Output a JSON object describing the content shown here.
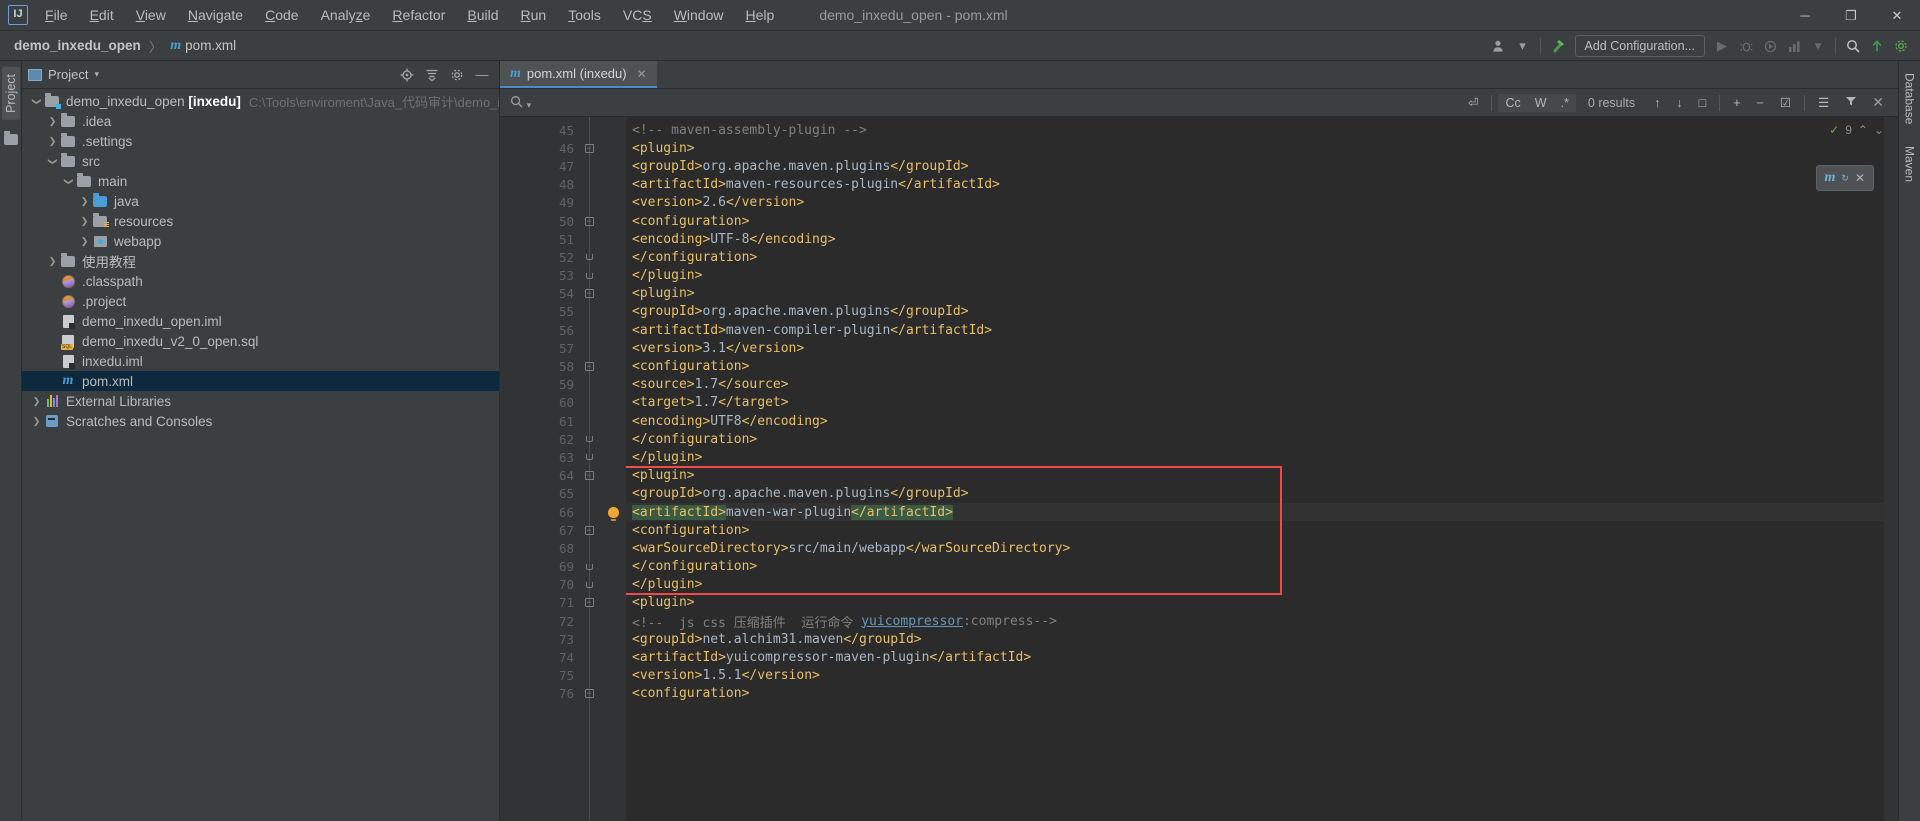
{
  "titlebar": {
    "logo": "IJ",
    "menus": [
      {
        "label": "File",
        "mnemonic": "F"
      },
      {
        "label": "Edit",
        "mnemonic": "E"
      },
      {
        "label": "View",
        "mnemonic": "V"
      },
      {
        "label": "Navigate",
        "mnemonic": "N"
      },
      {
        "label": "Code",
        "mnemonic": "C"
      },
      {
        "label": "Analyze",
        "mnemonic": "z"
      },
      {
        "label": "Refactor",
        "mnemonic": "R"
      },
      {
        "label": "Build",
        "mnemonic": "B"
      },
      {
        "label": "Run",
        "mnemonic": "R"
      },
      {
        "label": "Tools",
        "mnemonic": "T"
      },
      {
        "label": "VCS",
        "mnemonic": "S"
      },
      {
        "label": "Window",
        "mnemonic": "W"
      },
      {
        "label": "Help",
        "mnemonic": "H"
      }
    ],
    "window_title": "demo_inxedu_open - pom.xml",
    "minimize": "─",
    "maximize": "❐",
    "close": "✕"
  },
  "navbar": {
    "breadcrumb": [
      "demo_inxedu_open",
      "pom.xml"
    ],
    "separator": "〉",
    "file_icon": "maven-m-icon",
    "add_configuration": "Add Configuration...",
    "icons": [
      "user-avatar-icon",
      "chevron-down-icon",
      "build-hammer-icon",
      "run-icon",
      "debug-icon",
      "stop-icon",
      "coverage-icon",
      "profile-icon",
      "more-chevron-icon",
      "search-everywhere-icon",
      "update-project-icon",
      "settings-gear-icon"
    ]
  },
  "left_rail": {
    "tab": "Project",
    "extra_icon": "folder-icon"
  },
  "project_panel": {
    "title": "Project",
    "header_icons": [
      "target-locate-icon",
      "collapse-all-icon",
      "settings-gear-icon",
      "hide-icon"
    ],
    "tree": [
      {
        "indent": 0,
        "arrow": "v",
        "icon": "module-folder",
        "label": "demo_inxedu_open",
        "bold": "[inxedu]",
        "path": "C:\\Tools\\enviroment\\Java_代码审计\\demo_inx",
        "selected": false
      },
      {
        "indent": 1,
        "arrow": ">",
        "icon": "folder",
        "label": ".idea",
        "selected": false
      },
      {
        "indent": 1,
        "arrow": ">",
        "icon": "folder",
        "label": ".settings",
        "selected": false
      },
      {
        "indent": 1,
        "arrow": "v",
        "icon": "folder",
        "label": "src",
        "selected": false
      },
      {
        "indent": 2,
        "arrow": "v",
        "icon": "folder",
        "label": "main",
        "selected": false
      },
      {
        "indent": 3,
        "arrow": ">",
        "icon": "source-folder",
        "label": "java",
        "selected": false
      },
      {
        "indent": 3,
        "arrow": ">",
        "icon": "resource-folder",
        "label": "resources",
        "selected": false
      },
      {
        "indent": 3,
        "arrow": ">",
        "icon": "web-folder",
        "label": "webapp",
        "selected": false
      },
      {
        "indent": 1,
        "arrow": ">",
        "icon": "folder",
        "label": "使用教程",
        "selected": false
      },
      {
        "indent": 1,
        "arrow": "",
        "icon": "eclipse-file",
        "label": ".classpath",
        "selected": false
      },
      {
        "indent": 1,
        "arrow": "",
        "icon": "eclipse-file",
        "label": ".project",
        "selected": false
      },
      {
        "indent": 1,
        "arrow": "",
        "icon": "iml-file",
        "label": "demo_inxedu_open.iml",
        "selected": false
      },
      {
        "indent": 1,
        "arrow": "",
        "icon": "sql-file",
        "label": "demo_inxedu_v2_0_open.sql",
        "selected": false
      },
      {
        "indent": 1,
        "arrow": "",
        "icon": "iml-file",
        "label": "inxedu.iml",
        "selected": false
      },
      {
        "indent": 1,
        "arrow": "",
        "icon": "maven-m-icon",
        "label": "pom.xml",
        "selected": true
      },
      {
        "indent": 0,
        "arrow": ">",
        "icon": "library-icon",
        "label": "External Libraries",
        "selected": false
      },
      {
        "indent": 0,
        "arrow": ">",
        "icon": "scratches-icon",
        "label": "Scratches and Consoles",
        "selected": false
      }
    ]
  },
  "editor": {
    "tab": {
      "label": "pom.xml (inxedu)",
      "icon": "maven-m-icon",
      "close": "✕"
    },
    "search": {
      "icon": "search-icon",
      "placeholder": "",
      "value": "",
      "regex_icon": "⏎",
      "match_case": "Cc",
      "words": "W",
      "regex": ".*",
      "results": "0 results",
      "prev": "↑",
      "next": "↓",
      "select_all": "□",
      "add_line": "+",
      "remove_line": "−",
      "edit": "☑",
      "filter": "☰",
      "filter2": "ᐃ",
      "close": "✕"
    },
    "inspection": {
      "ok_icon": "✓",
      "count": "9",
      "up": "⌃",
      "down": "⌄"
    },
    "maven_popup": {
      "logo": "m",
      "badge": "refresh-icon",
      "close": "✕"
    },
    "first_line_number": 45,
    "lines": [
      {
        "n": 45,
        "indent": 8,
        "fold": "",
        "segs": [
          {
            "t": "<!-- maven-assembly-plugin -->",
            "c": "cmt"
          }
        ]
      },
      {
        "n": 46,
        "indent": 8,
        "fold": "start",
        "segs": [
          {
            "t": "<plugin>",
            "c": "tag"
          }
        ]
      },
      {
        "n": 47,
        "indent": 12,
        "fold": "",
        "segs": [
          {
            "t": "<groupId>",
            "c": "tag"
          },
          {
            "t": "org.apache.maven.plugins",
            "c": "txt"
          },
          {
            "t": "</groupId>",
            "c": "tag"
          }
        ]
      },
      {
        "n": 48,
        "indent": 12,
        "fold": "",
        "segs": [
          {
            "t": "<artifactId>",
            "c": "tag"
          },
          {
            "t": "maven-resources-plugin",
            "c": "txt"
          },
          {
            "t": "</artifactId>",
            "c": "tag"
          }
        ]
      },
      {
        "n": 49,
        "indent": 12,
        "fold": "",
        "segs": [
          {
            "t": "<version>",
            "c": "tag"
          },
          {
            "t": "2.6",
            "c": "txt"
          },
          {
            "t": "</version>",
            "c": "tag"
          }
        ]
      },
      {
        "n": 50,
        "indent": 12,
        "fold": "start",
        "segs": [
          {
            "t": "<configuration>",
            "c": "tag"
          }
        ]
      },
      {
        "n": 51,
        "indent": 16,
        "fold": "",
        "segs": [
          {
            "t": "<encoding>",
            "c": "tag"
          },
          {
            "t": "UTF-8",
            "c": "txt"
          },
          {
            "t": "</encoding>",
            "c": "tag"
          }
        ]
      },
      {
        "n": 52,
        "indent": 12,
        "fold": "end",
        "segs": [
          {
            "t": "</configuration>",
            "c": "tag"
          }
        ]
      },
      {
        "n": 53,
        "indent": 8,
        "fold": "end",
        "segs": [
          {
            "t": "</plugin>",
            "c": "tag"
          }
        ]
      },
      {
        "n": 54,
        "indent": 8,
        "fold": "start",
        "segs": [
          {
            "t": "<plugin>",
            "c": "tag"
          }
        ]
      },
      {
        "n": 55,
        "indent": 12,
        "fold": "",
        "segs": [
          {
            "t": "<groupId>",
            "c": "tag"
          },
          {
            "t": "org.apache.maven.plugins",
            "c": "txt"
          },
          {
            "t": "</groupId>",
            "c": "tag"
          }
        ]
      },
      {
        "n": 56,
        "indent": 12,
        "fold": "",
        "segs": [
          {
            "t": "<artifactId>",
            "c": "tag"
          },
          {
            "t": "maven-compiler-plugin",
            "c": "txt"
          },
          {
            "t": "</artifactId>",
            "c": "tag"
          }
        ]
      },
      {
        "n": 57,
        "indent": 12,
        "fold": "",
        "segs": [
          {
            "t": "<version>",
            "c": "tag"
          },
          {
            "t": "3.1",
            "c": "txt"
          },
          {
            "t": "</version>",
            "c": "tag"
          }
        ]
      },
      {
        "n": 58,
        "indent": 12,
        "fold": "start",
        "segs": [
          {
            "t": "<configuration>",
            "c": "tag"
          }
        ]
      },
      {
        "n": 59,
        "indent": 16,
        "fold": "",
        "segs": [
          {
            "t": "<source>",
            "c": "tag"
          },
          {
            "t": "1.7",
            "c": "txt"
          },
          {
            "t": "</source>",
            "c": "tag"
          }
        ]
      },
      {
        "n": 60,
        "indent": 16,
        "fold": "",
        "segs": [
          {
            "t": "<target>",
            "c": "tag"
          },
          {
            "t": "1.7",
            "c": "txt"
          },
          {
            "t": "</target>",
            "c": "tag"
          }
        ]
      },
      {
        "n": 61,
        "indent": 16,
        "fold": "",
        "segs": [
          {
            "t": "<encoding>",
            "c": "tag"
          },
          {
            "t": "UTF8",
            "c": "txt"
          },
          {
            "t": "</encoding>",
            "c": "tag"
          }
        ]
      },
      {
        "n": 62,
        "indent": 12,
        "fold": "end",
        "segs": [
          {
            "t": "</configuration>",
            "c": "tag"
          }
        ]
      },
      {
        "n": 63,
        "indent": 8,
        "fold": "end",
        "segs": [
          {
            "t": "</plugin>",
            "c": "tag"
          }
        ]
      },
      {
        "n": 64,
        "indent": 8,
        "fold": "start",
        "segs": [
          {
            "t": "<plugin>",
            "c": "tag"
          }
        ]
      },
      {
        "n": 65,
        "indent": 12,
        "fold": "",
        "segs": [
          {
            "t": "<groupId>",
            "c": "tag"
          },
          {
            "t": "org.apache.maven.plugins",
            "c": "txt"
          },
          {
            "t": "</groupId>",
            "c": "tag"
          }
        ]
      },
      {
        "n": 66,
        "indent": 12,
        "fold": "",
        "bulb": true,
        "highlight": true,
        "segs": [
          {
            "t": "<artifactId>",
            "c": "tag selg"
          },
          {
            "t": "maven-war-plugin",
            "c": "txt"
          },
          {
            "t": "</artifactId>",
            "c": "tag selg"
          }
        ]
      },
      {
        "n": 67,
        "indent": 12,
        "fold": "start",
        "segs": [
          {
            "t": "<configuration>",
            "c": "tag"
          }
        ]
      },
      {
        "n": 68,
        "indent": 16,
        "fold": "",
        "segs": [
          {
            "t": "<warSourceDirectory>",
            "c": "tag"
          },
          {
            "t": "src/main/webapp",
            "c": "txt"
          },
          {
            "t": "</warSourceDirectory>",
            "c": "tag"
          }
        ]
      },
      {
        "n": 69,
        "indent": 12,
        "fold": "end",
        "segs": [
          {
            "t": "</configuration>",
            "c": "tag"
          }
        ]
      },
      {
        "n": 70,
        "indent": 8,
        "fold": "end",
        "segs": [
          {
            "t": "</plugin>",
            "c": "tag"
          }
        ]
      },
      {
        "n": 71,
        "indent": 8,
        "fold": "start",
        "segs": [
          {
            "t": "<plugin>",
            "c": "tag"
          }
        ]
      },
      {
        "n": 72,
        "indent": 12,
        "fold": "",
        "segs": [
          {
            "t": "<!--  js css 压缩插件  运行命令 ",
            "c": "cmt"
          },
          {
            "t": "yuicompressor",
            "c": "cmt link"
          },
          {
            "t": ":compress-->",
            "c": "cmt"
          }
        ]
      },
      {
        "n": 73,
        "indent": 12,
        "fold": "",
        "segs": [
          {
            "t": "<groupId>",
            "c": "tag"
          },
          {
            "t": "net.alchim31.maven",
            "c": "txt"
          },
          {
            "t": "</groupId>",
            "c": "tag"
          }
        ]
      },
      {
        "n": 74,
        "indent": 12,
        "fold": "",
        "segs": [
          {
            "t": "<artifactId>",
            "c": "tag"
          },
          {
            "t": "yuicompressor-maven-plugin",
            "c": "txt"
          },
          {
            "t": "</artifactId>",
            "c": "tag"
          }
        ]
      },
      {
        "n": 75,
        "indent": 12,
        "fold": "",
        "segs": [
          {
            "t": "<version>",
            "c": "tag"
          },
          {
            "t": "1.5.1",
            "c": "txt"
          },
          {
            "t": "</version>",
            "c": "tag"
          }
        ]
      },
      {
        "n": 76,
        "indent": 12,
        "fold": "start",
        "segs": [
          {
            "t": "<configuration>",
            "c": "tag"
          }
        ]
      }
    ],
    "annotation_box": {
      "color": "#f04a4a",
      "from_line": 64,
      "to_line": 70
    }
  },
  "right_rail": {
    "tabs": [
      "Database",
      "Maven"
    ]
  },
  "colors": {
    "bg": "#3c3f41",
    "editor_bg": "#2b2b2b",
    "gutter_bg": "#313335",
    "accent": "#4a88c7",
    "tag": "#e8bf6a",
    "text": "#a9b7c6",
    "comment": "#808080",
    "selection_green": "#3a5a42",
    "annotation_red": "#f04a4a",
    "selected_row": "#0d293e"
  }
}
